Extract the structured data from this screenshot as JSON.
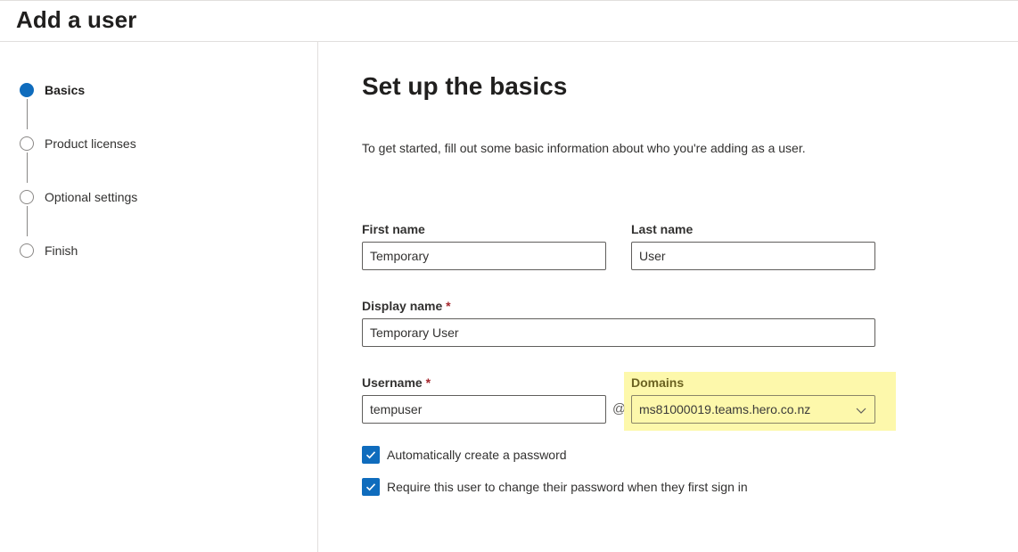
{
  "header": {
    "title": "Add a user"
  },
  "steps": [
    {
      "label": "Basics",
      "state": "current"
    },
    {
      "label": "Product licenses",
      "state": "pending"
    },
    {
      "label": "Optional settings",
      "state": "pending"
    },
    {
      "label": "Finish",
      "state": "pending"
    }
  ],
  "main": {
    "title": "Set up the basics",
    "intro": "To get started, fill out some basic information about who you're adding as a user."
  },
  "form": {
    "first_name": {
      "label": "First name",
      "value": "Temporary"
    },
    "last_name": {
      "label": "Last name",
      "value": "User"
    },
    "display_name": {
      "label": "Display name",
      "required_mark": "*",
      "value": "Temporary User"
    },
    "username": {
      "label": "Username",
      "required_mark": "*",
      "value": "tempuser"
    },
    "at_sign": "@",
    "domains": {
      "label": "Domains",
      "selected": "ms81000019.teams.hero.co.nz",
      "highlight_color": "#fdf79c"
    },
    "auto_password": {
      "label": "Automatically create a password",
      "checked": true
    },
    "require_change": {
      "label": "Require this user to change their password when they first sign in",
      "checked": true
    }
  },
  "colors": {
    "accent": "#0f6cbd",
    "required": "#a4262c",
    "border": "#605e5c"
  },
  "icons": {
    "step_current": "filled-circle-icon",
    "step_pending": "empty-circle-icon",
    "dropdown": "chevron-down-icon",
    "check": "checkmark-icon"
  }
}
